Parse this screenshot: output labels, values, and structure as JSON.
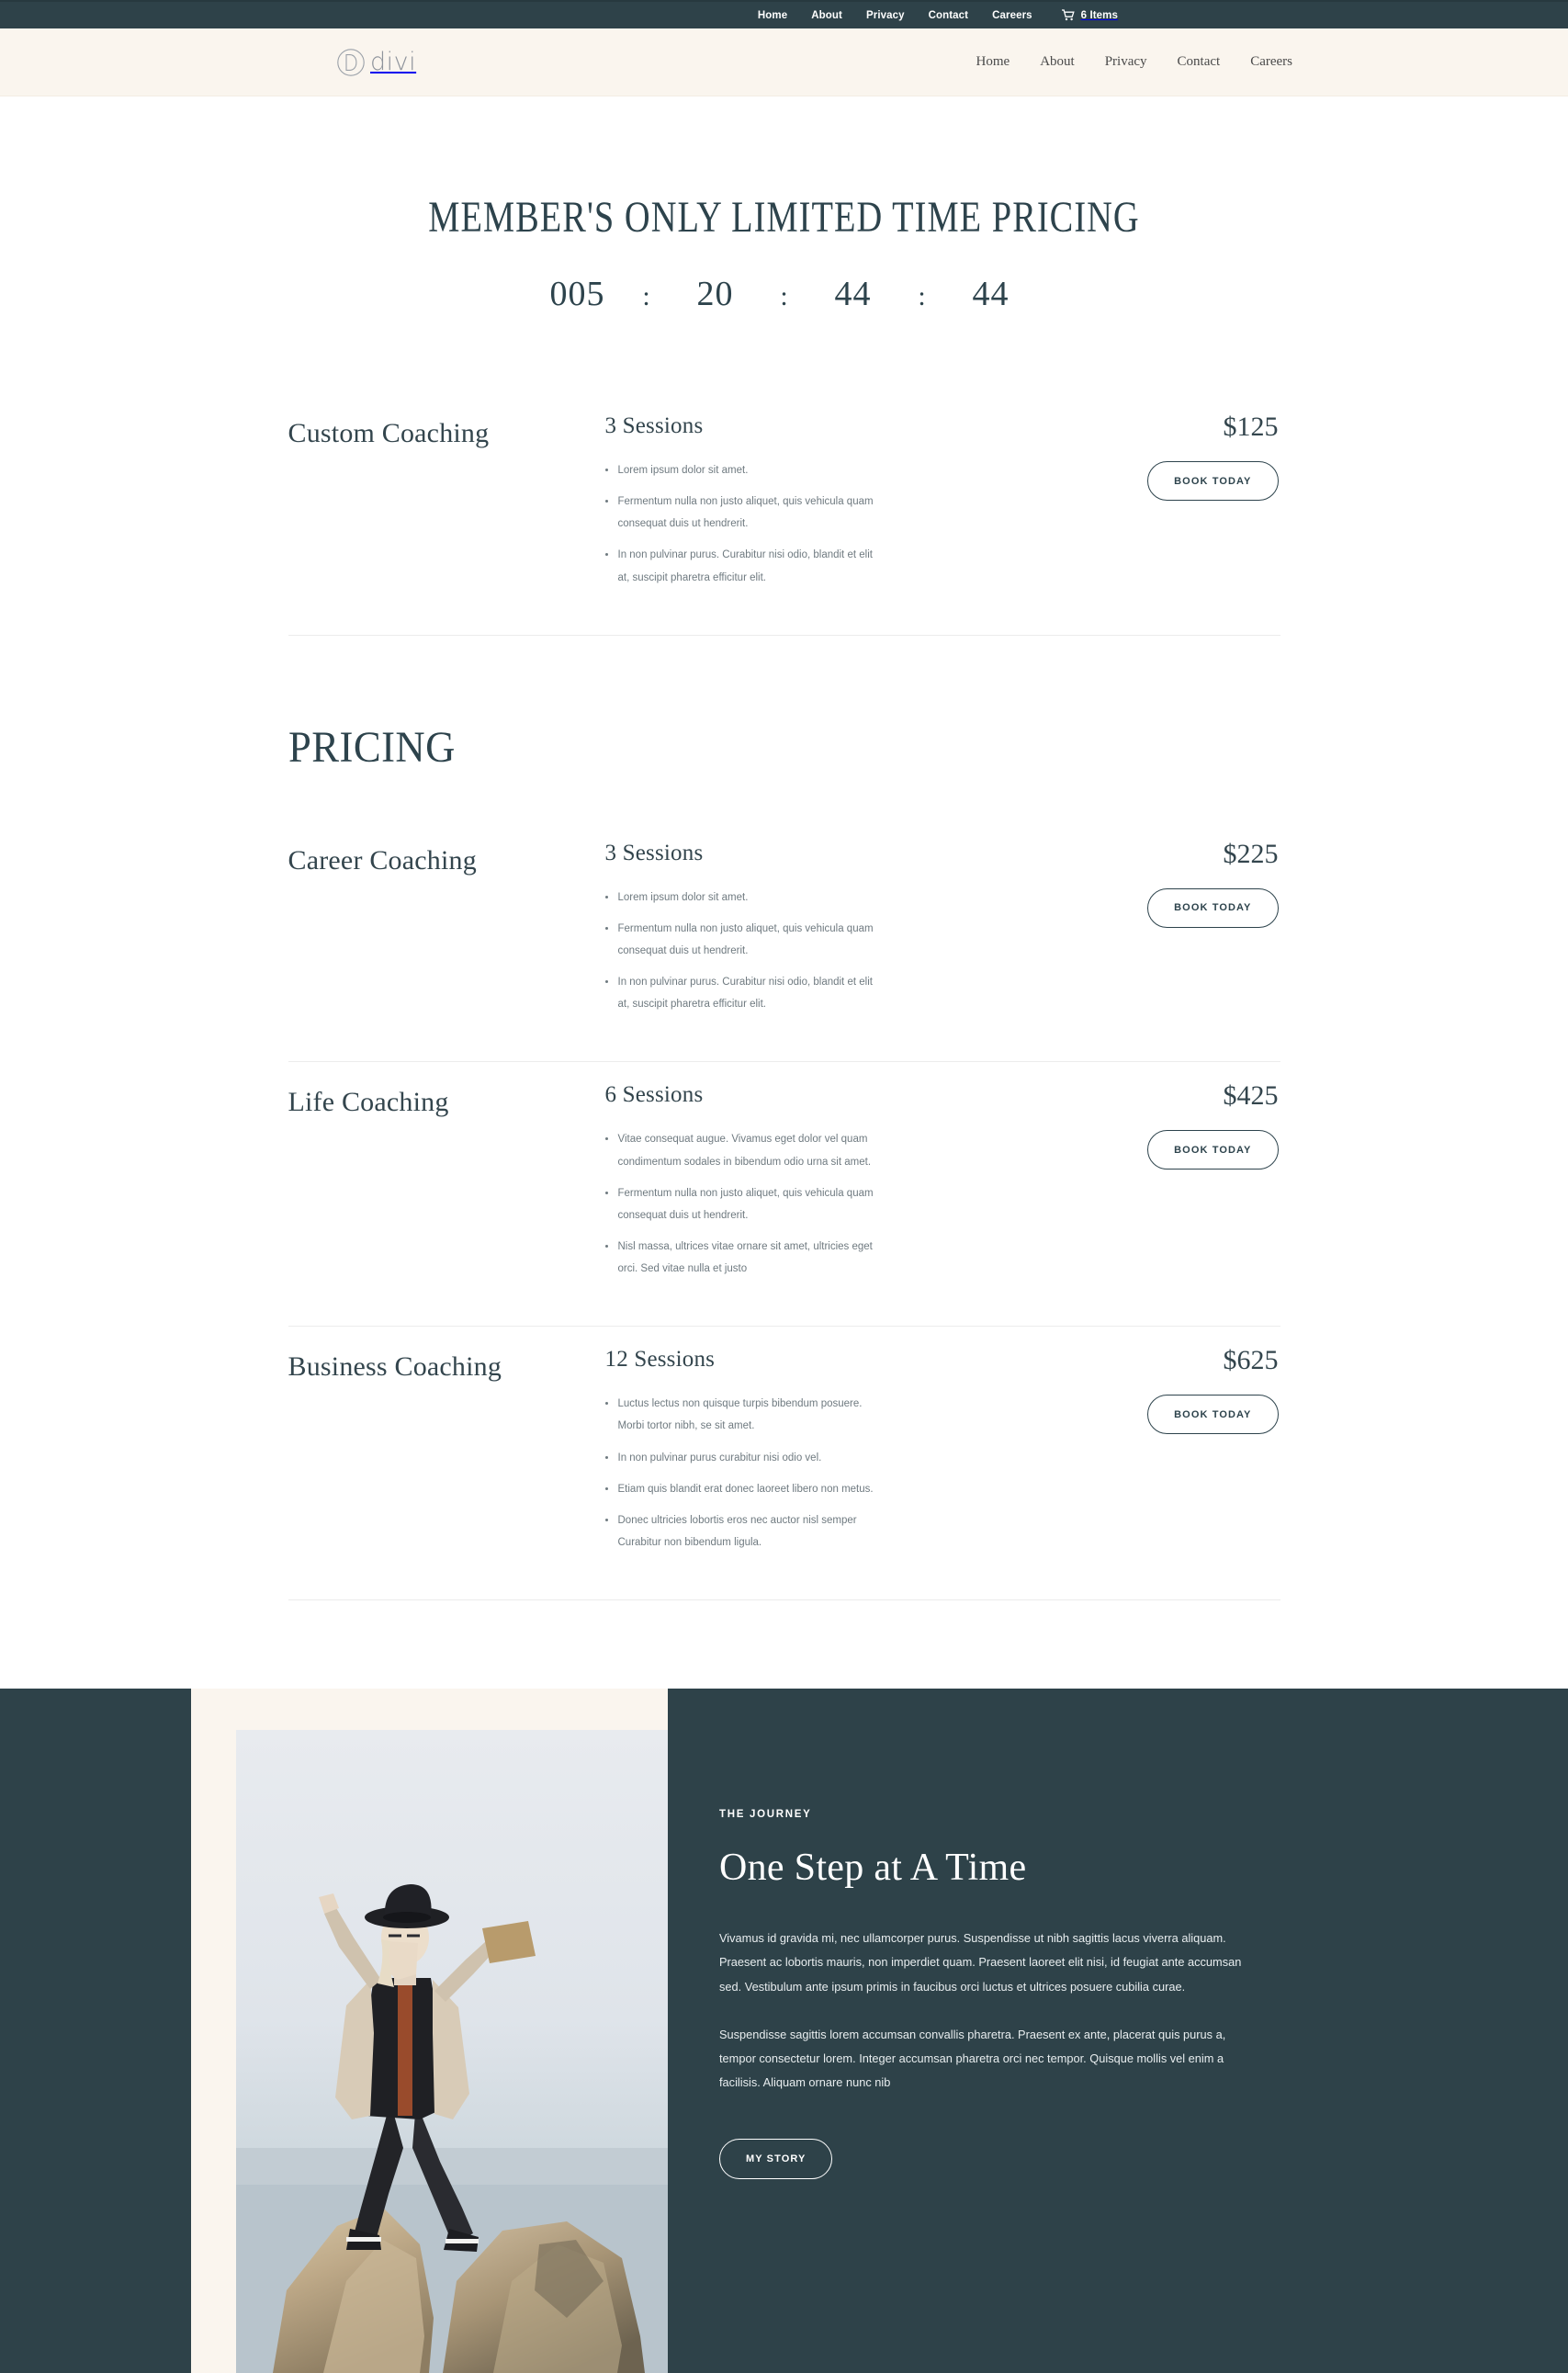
{
  "topbar": {
    "links": [
      {
        "label": "Home"
      },
      {
        "label": "About"
      },
      {
        "label": "Privacy"
      },
      {
        "label": "Contact"
      },
      {
        "label": "Careers"
      }
    ],
    "cart_icon": "shopping-cart-icon",
    "cart_label": "6 Items",
    "background": "#2e4249"
  },
  "header": {
    "logo_mark": "divi-circle-d-icon",
    "logo_text": "divi",
    "background": "#faf5ee",
    "nav": [
      {
        "label": "Home"
      },
      {
        "label": "About"
      },
      {
        "label": "Privacy"
      },
      {
        "label": "Contact"
      },
      {
        "label": "Careers"
      }
    ]
  },
  "promo": {
    "title": "MEMBER'S ONLY LIMITED TIME PRICING",
    "countdown": {
      "days": "005",
      "sep1": ":",
      "hours": "20",
      "sep2": ":",
      "minutes": "44",
      "sep3": ":",
      "seconds": "44"
    }
  },
  "featured": {
    "plan": {
      "name": "Custom Coaching",
      "sessions": "3 Sessions",
      "price": "$125",
      "cta": "BOOK TODAY",
      "features": [
        "Lorem ipsum dolor sit amet.",
        "Fermentum nulla non justo aliquet, quis vehicula quam consequat duis ut hendrerit.",
        "In non pulvinar purus. Curabitur nisi odio, blandit et elit at, suscipit pharetra efficitur elit."
      ]
    }
  },
  "pricing": {
    "heading": "PRICING",
    "plans": [
      {
        "name": "Career Coaching",
        "sessions": "3 Sessions",
        "price": "$225",
        "cta": "BOOK TODAY",
        "features": [
          "Lorem ipsum dolor sit amet.",
          "Fermentum nulla non justo aliquet, quis vehicula quam consequat duis ut hendrerit.",
          "In non pulvinar purus. Curabitur nisi odio, blandit et elit at, suscipit pharetra efficitur elit."
        ]
      },
      {
        "name": "Life Coaching",
        "sessions": "6 Sessions",
        "price": "$425",
        "cta": "BOOK TODAY",
        "features": [
          "Vitae consequat augue. Vivamus eget dolor vel quam condimentum sodales in bibendum odio urna sit amet.",
          "Fermentum nulla non justo aliquet, quis vehicula quam consequat duis ut hendrerit.",
          "Nisl massa, ultrices vitae ornare sit amet, ultricies eget orci. Sed vitae nulla et justo"
        ]
      },
      {
        "name": "Business Coaching",
        "sessions": "12 Sessions",
        "price": "$625",
        "cta": "BOOK TODAY",
        "features": [
          "Luctus lectus non quisque turpis bibendum posuere. Morbi tortor nibh, se  sit amet.",
          "In non pulvinar purus curabitur nisi odio vel.",
          "Etiam quis blandit erat donec laoreet libero non metus.",
          "Donec ultricies lobortis eros nec auctor nisl semper Curabitur non bibendum ligula."
        ]
      }
    ]
  },
  "journey": {
    "eyebrow": "THE JOURNEY",
    "title": "One Step at A Time",
    "paragraph1": "Vivamus id gravida mi, nec ullamcorper purus. Suspendisse ut nibh sagittis lacus viverra aliquam. Praesent ac lobortis mauris, non imperdiet quam. Praesent laoreet elit nisi, id feugiat ante accumsan sed. Vestibulum ante ipsum primis in faucibus orci luctus et ultrices posuere cubilia curae.",
    "paragraph2": "Suspendisse sagittis lorem accumsan convallis pharetra. Praesent ex ante, placerat quis purus a, tempor consectetur lorem. Integer accumsan pharetra orci nec tempor. Quisque mollis vel enim a facilisis. Aliquam ornare nunc nib",
    "cta": "MY STORY",
    "photo_alt": "person-stepping-between-rocks-photo",
    "background": "#2e4249"
  }
}
